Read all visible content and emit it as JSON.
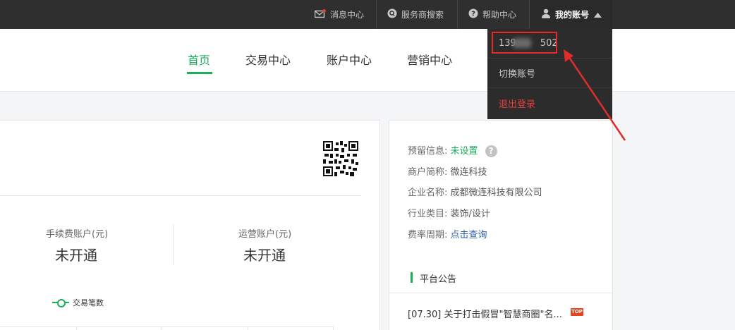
{
  "topbar": {
    "messages": "消息中心",
    "provider_search": "服务商搜索",
    "help": "帮助中心",
    "account": "我的账号"
  },
  "nav": {
    "home": "首页",
    "trade": "交易中心",
    "account": "账户中心",
    "marketing": "营销中心"
  },
  "dropdown": {
    "phone_prefix": "139",
    "phone_suffix": "502",
    "switch_account": "切换账号",
    "logout": "退出登录"
  },
  "accounts": {
    "fee_label": "手续费账户(元)",
    "fee_value": "未开通",
    "ops_label": "运营账户(元)",
    "ops_value": "未开通"
  },
  "legend": {
    "trade_count": "交易笔数"
  },
  "info": {
    "reserved_label": "预留信息:",
    "reserved_value": "未设置",
    "short_name_label": "商户简称:",
    "short_name_value": "微连科技",
    "company_label": "企业名称:",
    "company_value": "成都微连科技有限公司",
    "industry_label": "行业类目:",
    "industry_value": "装饰/设计",
    "rate_label": "费率周期:",
    "rate_value": "点击查询"
  },
  "notice": {
    "title": "平台公告",
    "item": "[07.30] 关于打击假冒\"智慧商圈\"名...",
    "badge": "TOP"
  },
  "colors": {
    "accent": "#1aad5c",
    "alert": "#e22b2b",
    "link": "#2e5fa8"
  }
}
